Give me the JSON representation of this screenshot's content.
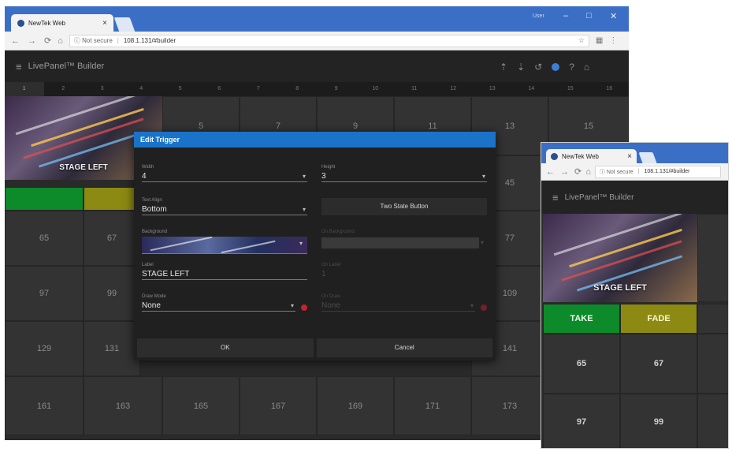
{
  "main_window": {
    "tab_title": "NewTek Web",
    "tab_close": "×",
    "user_badge": "User",
    "win_min": "–",
    "win_max": "□",
    "win_close": "✕",
    "security": "ⓘ Not secure",
    "url": "108.1.131/#builder",
    "app_title": "LivePanel™ Builder",
    "column_headers": [
      "1",
      "2",
      "3",
      "4",
      "5",
      "6",
      "7",
      "8",
      "9",
      "10",
      "11",
      "12",
      "13",
      "14",
      "15",
      "16"
    ],
    "selected_column": 0,
    "cells": [
      {
        "id": "5",
        "label": "5"
      },
      {
        "id": "7",
        "label": "7"
      },
      {
        "id": "9",
        "label": "9"
      },
      {
        "id": "11",
        "label": "11"
      },
      {
        "id": "13",
        "label": "13"
      },
      {
        "id": "15",
        "label": "15"
      },
      {
        "id": "45",
        "label": "45"
      },
      {
        "id": "65",
        "label": "65"
      },
      {
        "id": "67",
        "label": "67"
      },
      {
        "id": "77",
        "label": "77"
      },
      {
        "id": "97",
        "label": "97"
      },
      {
        "id": "99",
        "label": "99"
      },
      {
        "id": "109",
        "label": "109"
      },
      {
        "id": "129",
        "label": "129"
      },
      {
        "id": "131",
        "label": "131"
      },
      {
        "id": "141",
        "label": "141"
      },
      {
        "id": "161",
        "label": "161"
      },
      {
        "id": "163",
        "label": "163"
      },
      {
        "id": "165",
        "label": "165"
      },
      {
        "id": "167",
        "label": "167"
      },
      {
        "id": "169",
        "label": "169"
      },
      {
        "id": "171",
        "label": "171"
      },
      {
        "id": "173",
        "label": "173"
      }
    ],
    "image_cell_label": "STAGE LEFT"
  },
  "dialog": {
    "title": "Edit Trigger",
    "width_label": "Width",
    "width_value": "4",
    "height_label": "Height",
    "height_value": "3",
    "text_align_label": "Text Align",
    "text_align_value": "Bottom",
    "two_state_button": "Two State Button",
    "background_label": "Background",
    "on_background_label": "On Background",
    "label_label": "Label",
    "label_value": "STAGE LEFT",
    "on_label_label": "On Label",
    "on_label_value": "1",
    "drawmode_label": "Draw Mode",
    "drawmode_value": "None",
    "on_drawmode_label": "On Draw",
    "on_drawmode_value": "None",
    "ok": "OK",
    "cancel": "Cancel"
  },
  "small_window": {
    "tab_title": "NewTek Web",
    "tab_close": "×",
    "security": "ⓘ Not secure",
    "url": "108.1.131/#builder",
    "app_title": "LivePanel™ Builder",
    "image_cell_label": "STAGE LEFT",
    "take": "TAKE",
    "fade": "FADE",
    "cells": [
      "65",
      "67",
      "97",
      "99"
    ]
  },
  "colors": {
    "chrome_blue": "#3b6fc6",
    "dialog_title": "#1a73c8",
    "take_green": "#0d8a2a",
    "fade_olive": "#8c8a12",
    "record_red": "#c8222a"
  },
  "icons": {
    "main_toolbar": [
      "upload-icon",
      "download-icon",
      "history-icon",
      "color-dot-icon",
      "help-icon",
      "home-icon"
    ]
  }
}
